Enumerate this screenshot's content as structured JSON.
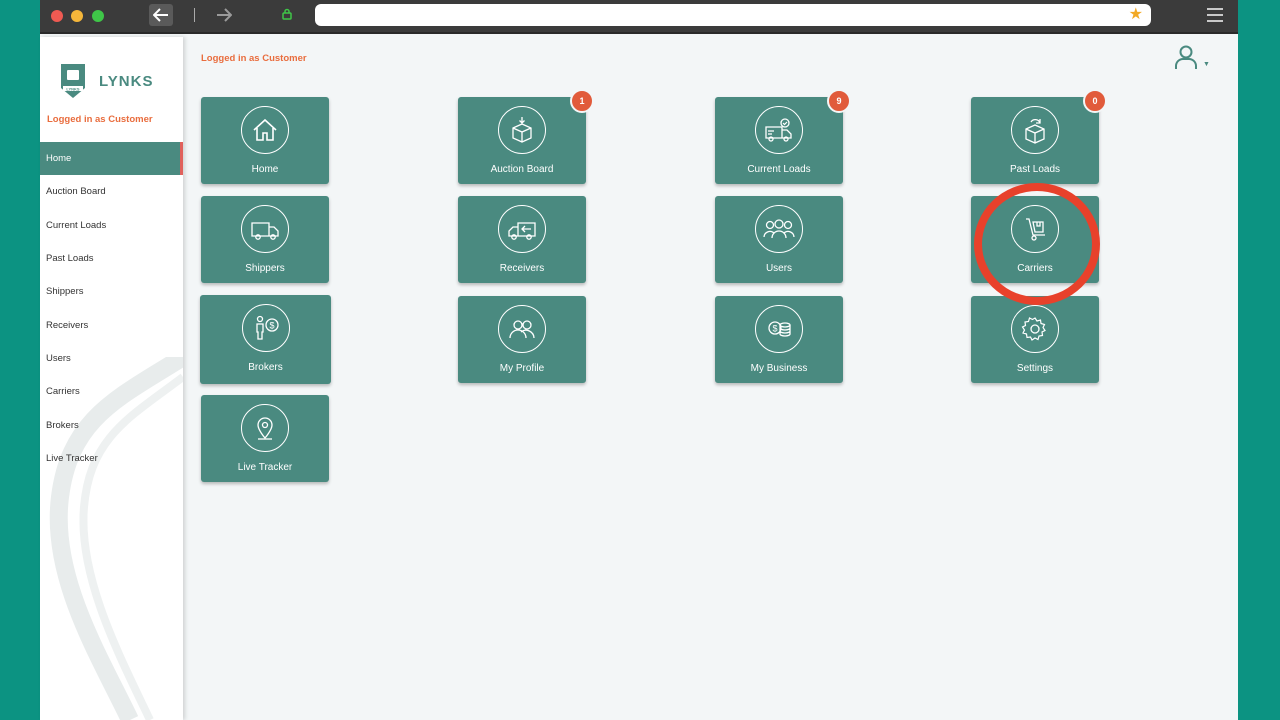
{
  "browser": {
    "url": ""
  },
  "brand": {
    "name": "LYNKS",
    "badge_text": "LYNKS",
    "color": "#4a8a80"
  },
  "status": {
    "logged_in_text": "Logged in as Customer",
    "color": "#e96d3e"
  },
  "sidebar": {
    "items": [
      {
        "label": "Home",
        "active": true
      },
      {
        "label": "Auction Board"
      },
      {
        "label": "Current Loads"
      },
      {
        "label": "Past Loads"
      },
      {
        "label": "Shippers"
      },
      {
        "label": "Receivers"
      },
      {
        "label": "Users"
      },
      {
        "label": "Carriers"
      },
      {
        "label": "Brokers"
      },
      {
        "label": "Live Tracker"
      }
    ]
  },
  "tiles": [
    {
      "label": "Home",
      "icon": "home-icon"
    },
    {
      "label": "Auction Board",
      "icon": "box-download-icon",
      "badge": "1"
    },
    {
      "label": "Current Loads",
      "icon": "truck-check-icon",
      "badge": "9"
    },
    {
      "label": "Past Loads",
      "icon": "box-return-icon",
      "badge": "0"
    },
    {
      "label": "Shippers",
      "icon": "truck-icon"
    },
    {
      "label": "Receivers",
      "icon": "truck-arrow-icon"
    },
    {
      "label": "Users",
      "icon": "users-group-icon"
    },
    {
      "label": "Carriers",
      "icon": "hand-truck-icon"
    },
    {
      "label": "Brokers",
      "icon": "broker-dollar-icon"
    },
    {
      "label": "My Profile",
      "icon": "two-people-icon"
    },
    {
      "label": "My Business",
      "icon": "coins-icon"
    },
    {
      "label": "Settings",
      "icon": "gear-icon"
    },
    {
      "label": "Live Tracker",
      "icon": "map-pin-icon"
    }
  ],
  "colors": {
    "tile": "#4a8a80",
    "badge": "#e15b3b",
    "highlight": "#e8412b",
    "frame": "#0c9382"
  }
}
